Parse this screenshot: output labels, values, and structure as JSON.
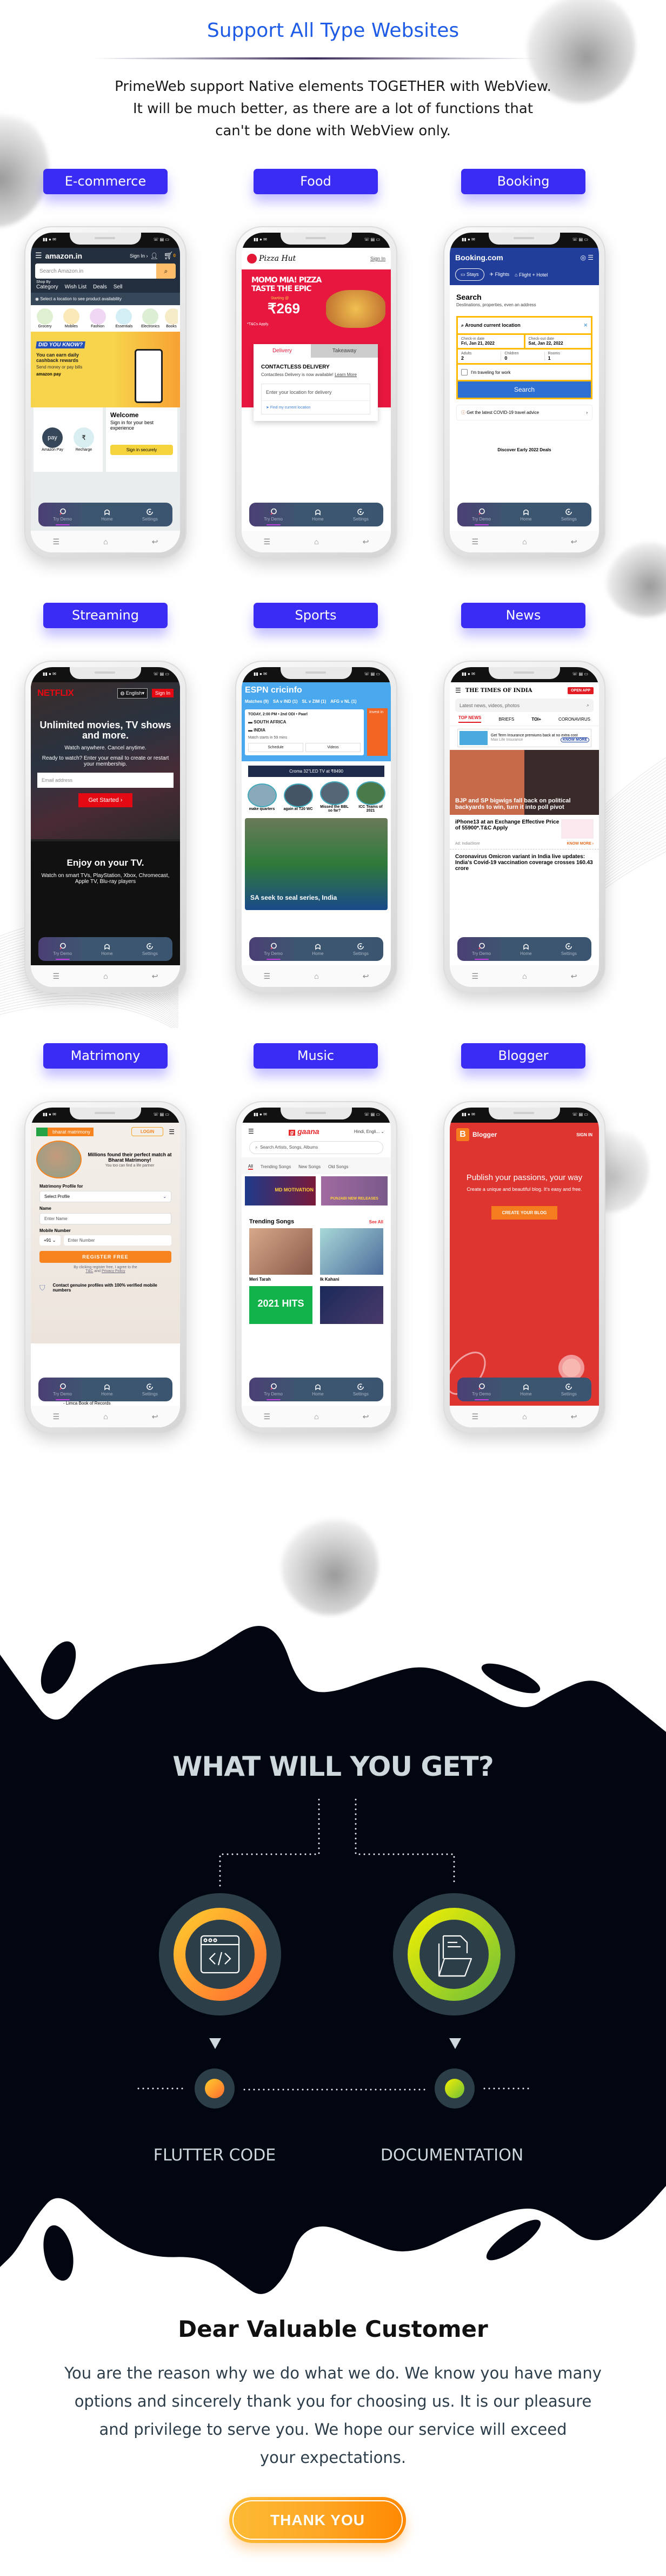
{
  "header": {
    "title": "Support All Type Websites",
    "intro_lines": [
      "PrimeWeb support Native elements TOGETHER with WebView.",
      "It will be much better, as there are a lot of functions that",
      "can't be done with WebView only."
    ]
  },
  "colors": {
    "title": "#1e5be6",
    "label_bg": "#3a2cf2",
    "dark_bg": "#020611",
    "button_orange": "#ff8800"
  },
  "demo_nav": {
    "items": [
      {
        "label": "Try Demo",
        "icon": "search-icon"
      },
      {
        "label": "Home",
        "icon": "home-icon"
      },
      {
        "label": "Settings",
        "icon": "settings-icon"
      }
    ]
  },
  "phones": [
    {
      "label": "E-commerce",
      "screen": {
        "logo": "amazon.in",
        "sign_in": "Sign In ›",
        "cart_count": "0",
        "search_placeholder": "Search Amazon.in",
        "shop_by": "Shop By",
        "nav": [
          "Category",
          "Wish List",
          "Deals",
          "Sell"
        ],
        "location": "Select a location to see product availability",
        "categories": [
          "Grocery",
          "Mobiles",
          "Fashion",
          "Essentials",
          "Electronics",
          "Books"
        ],
        "banner_badge": "DID YOU KNOW?",
        "banner_title": "You can earn daily cashback rewards",
        "banner_sub": "Send money or pay bills",
        "banner_brand": "amazon pay",
        "tiles": [
          "Amazon Pay",
          "Recharge"
        ],
        "welcome": "Welcome",
        "welcome_sub": "Sign in for your best experience",
        "signin_btn": "Sign in securely"
      }
    },
    {
      "label": "Food",
      "screen": {
        "logo": "Pizza Hut",
        "sign_in": "Sign In",
        "promo1": "MOMO MIA! PIZZA",
        "promo2": "TASTE THE EPIC",
        "starting": "Starting @",
        "price": "₹269",
        "tnc": "*T&Cs Apply.",
        "tabs": [
          "Delivery",
          "Takeaway"
        ],
        "heading": "CONTACTLESS DELIVERY",
        "desc": "Contactless Delivery is now available!",
        "learn_more": "Learn More",
        "location_placeholder": "Enter your location for delivery",
        "find_location": "Find my current location"
      }
    },
    {
      "label": "Booking",
      "screen": {
        "logo": "Booking.com",
        "tabs": [
          "Stays",
          "Flights",
          "Flight + Hotel"
        ],
        "search_title": "Search",
        "search_sub": "Destinations, properties, even an address",
        "destination": "Around current location",
        "checkin_label": "Check-in date",
        "checkin": "Fri, Jan 21, 2022",
        "checkout_label": "Check-out date",
        "checkout": "Sat, Jan 22, 2022",
        "adults_label": "Adults",
        "adults": "2",
        "children_label": "Children",
        "children": "0",
        "rooms_label": "Rooms",
        "rooms": "1",
        "work": "I'm traveling for work",
        "search_btn": "Search",
        "covid": "Get the latest COVID-19 travel advice",
        "deals": "Discover Early 2022 Deals"
      }
    },
    {
      "label": "Streaming",
      "screen": {
        "logo": "NETFLIX",
        "language": "English",
        "sign_in": "Sign In",
        "headline": "Unlimited movies, TV shows and more.",
        "sub": "Watch anywhere. Cancel anytime.",
        "ready": "Ready to watch? Enter your email to create or restart your membership.",
        "email_placeholder": "Email address",
        "get_started": "Get Started ›",
        "tv_title": "Enjoy on your TV.",
        "tv_desc": "Watch on smart TVs, PlayStation, Xbox, Chromecast, Apple TV, Blu-ray players"
      }
    },
    {
      "label": "Sports",
      "screen": {
        "logo": "ESPN cricinfo",
        "tabs": [
          "Matches (9)",
          "SA v IND (1)",
          "SL v ZIM (1)",
          "AFG v NL (1)"
        ],
        "match_info": "TODAY, 2:00 PM • 2nd ODI • Paarl",
        "team1": "SOUTH AFRICA",
        "team2": "INDIA",
        "starts": "Match starts in 59 mins",
        "buttons": [
          "Schedule",
          "Videos"
        ],
        "ad": "Croma 32\"LED TV at ₹8490",
        "ad_side": "Invest in",
        "stories": [
          "make quarters",
          "again at T20 WC",
          "Missed the BBL so far?",
          "ICC Teams of 2021"
        ],
        "headline": "SA seek to seal series, India"
      }
    },
    {
      "label": "News",
      "screen": {
        "logo": "THE TIMES OF INDIA",
        "open_app": "OPEN APP",
        "search_placeholder": "Latest news, videos, photos",
        "tabs": [
          "TOP NEWS",
          "BRIEFS",
          "TOI+",
          "CORONAVIRUS"
        ],
        "ad_text": "Get Term Insurance premiums back at no extra cost",
        "ad_brand": "Max Life Insurance",
        "ad_cta": "KNOW MORE",
        "headline": "BJP and SP bigwigs fall back on political backyards to win, turn it into poll pivot",
        "promo": "iPhone13 at an Exchange Effective Price of 55900*.T&C Apply",
        "promo_src": "Ad: IndiaiStore",
        "promo_cta": "KNOW MORE ›",
        "story": "Coronavirus Omicron variant in India live updates: India's Covid-19 vaccination coverage crosses 160.43 crore"
      }
    },
    {
      "label": "Matrimony",
      "screen": {
        "logo": "bharat matrimony",
        "login": "LOGIN",
        "hero": "Millions found their perfect match at Bharat Matrimony!",
        "hero_sub": "You too can find a life partner",
        "profile_label": "Matrimony Profile for",
        "profile_select": "Select Profile",
        "name_label": "Name",
        "name_placeholder": "Enter Name",
        "mobile_label": "Mobile Number",
        "country_code": "+91",
        "mobile_placeholder": "Enter Number",
        "register": "REGISTER FREE",
        "agree": "By clicking register free, I agree to the",
        "tnc": "T&C",
        "and": "and",
        "privacy": "Privacy Policy",
        "genuine": "Contact genuine profiles with 100% verified mobile numbers",
        "limca": "- Limca Book of Records"
      }
    },
    {
      "label": "Music",
      "screen": {
        "logo": "gaana",
        "language": "Hindi, Engli...",
        "search_placeholder": "Search Artists, Songs, Albums",
        "tabs": [
          "All",
          "Trending Songs",
          "New Songs",
          "Old Songs"
        ],
        "banners": [
          "MD MOTIVATION",
          "PUNJABI NEW RELEASES"
        ],
        "section": "Trending Songs",
        "see_all": "See All",
        "songs": [
          "Meri Tarah",
          "Ik Kahani"
        ],
        "tile": "2021 HITS"
      }
    },
    {
      "label": "Blogger",
      "screen": {
        "logo": "Blogger",
        "sign_in": "SIGN IN",
        "headline": "Publish your passions, your way",
        "sub": "Create a unique and beautiful blog. It's easy and free.",
        "cta": "CREATE YOUR BLOG"
      }
    }
  ],
  "get": {
    "title": "WHAT WILL YOU GET?",
    "items": [
      {
        "label": "FLUTTER CODE",
        "icon": "code-window-icon"
      },
      {
        "label": "DOCUMENTATION",
        "icon": "document-folder-icon"
      }
    ]
  },
  "closing": {
    "title": "Dear Valuable Customer",
    "lines": [
      "You are the reason why we do what we do. We know you have many",
      "options and sincerely thank you for choosing us. It is our pleasure",
      "and privilege to serve you. We hope our service will exceed",
      "your expectations."
    ],
    "button": "THANK YOU"
  }
}
